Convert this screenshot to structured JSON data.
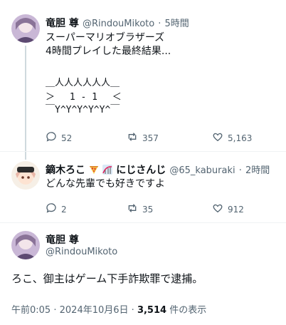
{
  "tweet1": {
    "name": "竜胆 尊",
    "handle": "@RindouMikoto",
    "dot": "·",
    "time": "5時間",
    "text_lines": [
      "スーパーマリオブラザーズ",
      "4時間プレイした最終結果..."
    ],
    "aa_lines": [
      "＿人人人人人人＿",
      "＞　 1 - 1 　＜",
      "￣Y^Y^Y^Y^Y^￣"
    ],
    "reply_count": "52",
    "retweet_count": "357",
    "like_count": "5,163"
  },
  "tweet2": {
    "name": "鏑木ろこ",
    "name_suffix": "にじさんじ",
    "handle": "@65_kaburaki",
    "dot": "·",
    "time": "2時間",
    "text": "どんな先輩でも好きですよ",
    "reply_count": "2",
    "retweet_count": "35",
    "like_count": "912"
  },
  "main_tweet": {
    "name": "竜胆 尊",
    "handle": "@RindouMikoto",
    "text": "ろこ、御主はゲーム下手詐欺罪で逮捕。",
    "time": "午前0:05",
    "dot1": "·",
    "date": "2024年10月6日",
    "dot2": "·",
    "views": "3,514",
    "views_label": "件の表示"
  },
  "colors": {
    "muted": "#536471",
    "text": "#0f1419",
    "line": "#cfd9de"
  }
}
